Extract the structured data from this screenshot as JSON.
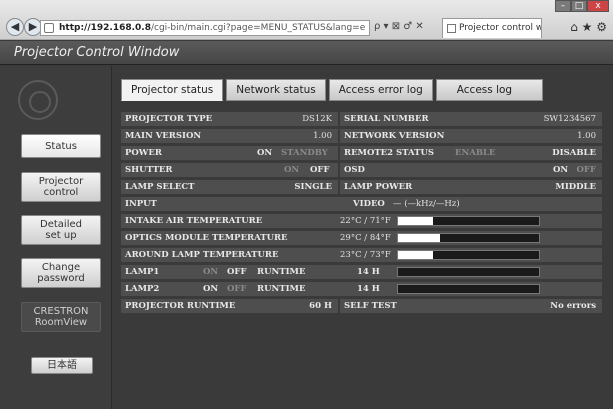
{
  "browser": {
    "url_host": "http://192.168.0.8",
    "url_path": "/cgi-bin/main.cgi?page=MENU_STATUS&lang=e",
    "addr_tools": "ρ ▾ ⊠ ♂ ✕",
    "tab_title": "Projector control window",
    "tab_close": "×",
    "back": "◀",
    "forward": "▶",
    "win_min": "–",
    "win_max": "□",
    "win_close": "x",
    "right_icons": "⌂ ★ ⚙"
  },
  "app": {
    "title": "Projector Control Window"
  },
  "sidebar": {
    "items": [
      {
        "label": "Status"
      },
      {
        "label": "Projector\ncontrol"
      },
      {
        "label": "Detailed\nset up"
      },
      {
        "label": "Change\npassword"
      },
      {
        "label": "CRESTRON\nRoomView"
      },
      {
        "label": "日本語"
      }
    ]
  },
  "tabs": [
    "Projector status",
    "Network status",
    "Access error log",
    "Access log"
  ],
  "status": {
    "projector_type_label": "PROJECTOR TYPE",
    "projector_type": "DS12K",
    "serial_label": "SERIAL NUMBER",
    "serial": "SW1234567",
    "main_version_label": "MAIN VERSION",
    "main_version": "1.00",
    "network_version_label": "NETWORK VERSION",
    "network_version": "1.00",
    "power_label": "POWER",
    "power_on": "ON",
    "power_standby": "STANDBY",
    "remote2_label": "REMOTE2 STATUS",
    "remote2_enable": "ENABLE",
    "remote2_disable": "DISABLE",
    "shutter_label": "SHUTTER",
    "shutter_on": "ON",
    "shutter_off": "OFF",
    "osd_label": "OSD",
    "osd_on": "ON",
    "osd_off": "OFF",
    "lamp_select_label": "LAMP SELECT",
    "lamp_select": "SINGLE",
    "lamp_power_label": "LAMP POWER",
    "lamp_power": "MIDDLE",
    "input_label": "INPUT",
    "input_value": "VIDEO",
    "input_freq": "— (—kHz/—Hz)",
    "intake_label": "INTAKE AIR TEMPERATURE",
    "intake_value": "22°C / 71°F",
    "intake_level": 0.25,
    "optics_label": "OPTICS MODULE TEMPERATURE",
    "optics_value": "29°C / 84°F",
    "optics_level": 0.3,
    "around_label": "AROUND LAMP TEMPERATURE",
    "around_value": "23°C / 73°F",
    "around_level": 0.25,
    "lamp1_label": "LAMP1",
    "lamp1_on": "ON",
    "lamp1_off": "OFF",
    "lamp1_runtime_label": "RUNTIME",
    "lamp1_runtime": "14 H",
    "lamp2_label": "LAMP2",
    "lamp2_on": "ON",
    "lamp2_off": "OFF",
    "lamp2_runtime_label": "RUNTIME",
    "lamp2_runtime": "14 H",
    "projector_runtime_label": "PROJECTOR RUNTIME",
    "projector_runtime": "60 H",
    "self_test_label": "SELF TEST",
    "self_test": "No errors"
  }
}
